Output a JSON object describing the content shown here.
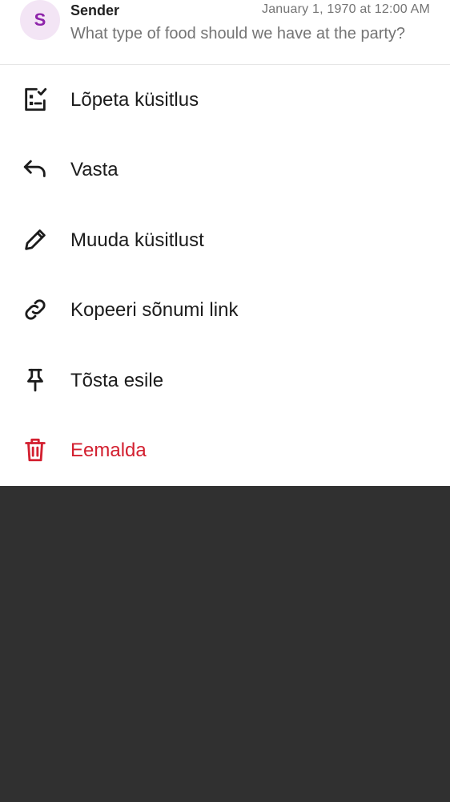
{
  "header": {
    "avatar_initial": "S",
    "sender": "Sender",
    "timestamp": "January 1, 1970 at 12:00 AM",
    "preview": "What type of food should we have at the party?"
  },
  "menu": {
    "items": [
      {
        "label": "Lõpeta küsitlus",
        "icon": "end-poll-icon"
      },
      {
        "label": "Vasta",
        "icon": "reply-icon"
      },
      {
        "label": "Muuda küsitlust",
        "icon": "pencil-icon"
      },
      {
        "label": "Kopeeri sõnumi link",
        "icon": "link-icon"
      },
      {
        "label": "Tõsta esile",
        "icon": "pin-icon"
      },
      {
        "label": "Eemalda",
        "icon": "trash-icon"
      }
    ]
  },
  "colors": {
    "danger": "#d32030",
    "text": "#1c1c1c",
    "muted": "#747474",
    "avatar_bg": "#f3e5f5",
    "avatar_fg": "#8e24aa",
    "backdrop": "#303030"
  }
}
